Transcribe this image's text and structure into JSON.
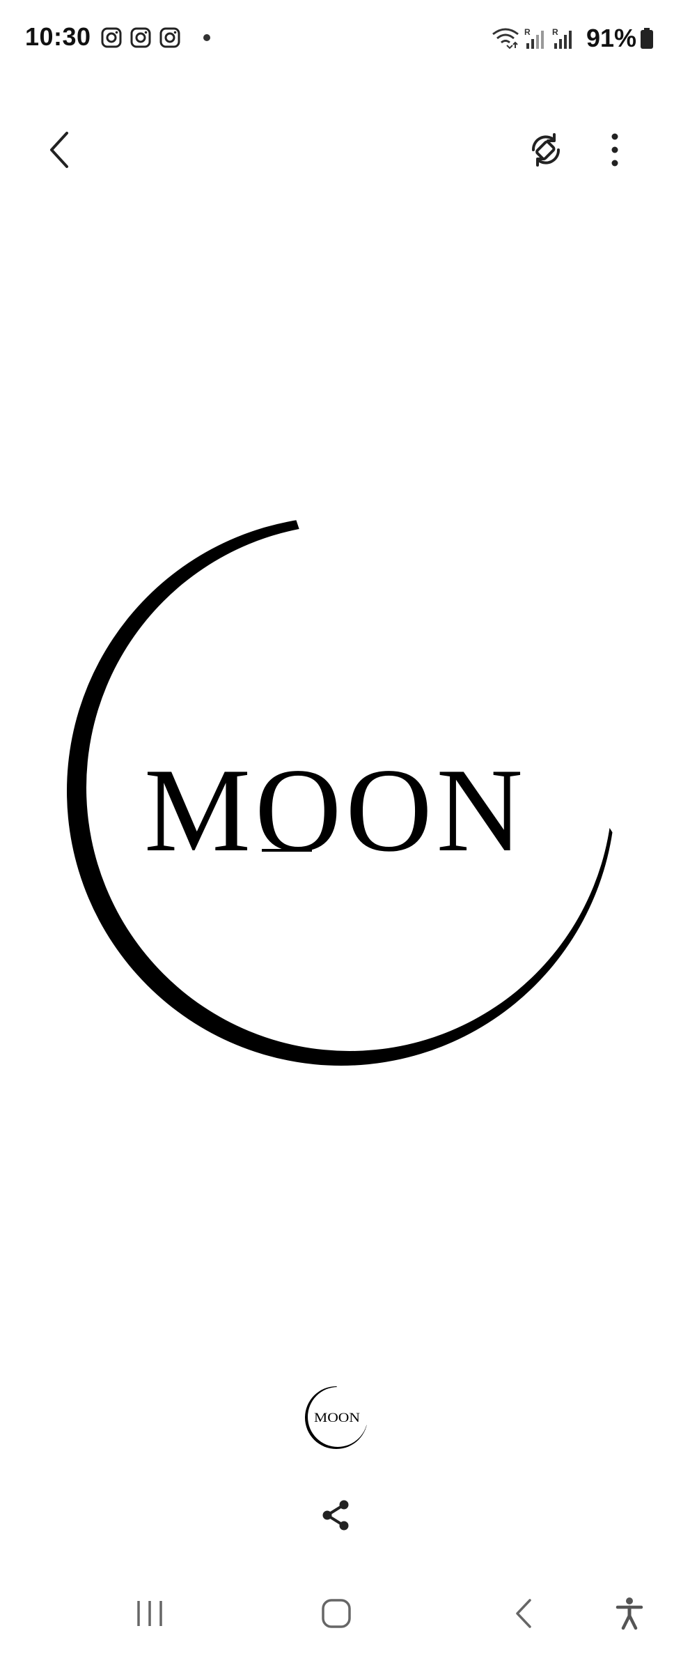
{
  "status_bar": {
    "time": "10:30",
    "notification_icons": [
      "instagram-icon",
      "instagram-icon",
      "instagram-icon",
      "dot-icon"
    ],
    "status_icons": [
      "wifi-icon",
      "signal-icon",
      "signal-icon"
    ],
    "signal_labels": [
      "R",
      "R"
    ],
    "battery_percent": "91%"
  },
  "top_bar": {
    "back_icon": "chevron-left-icon",
    "rotate_icon": "screen-rotate-icon",
    "more_icon": "more-vertical-icon"
  },
  "image": {
    "logo_text": "MOON",
    "thumbnail_text": "MOON",
    "ink_color": "#000000",
    "background_color": "#ffffff"
  },
  "actions": {
    "share_icon": "share-icon"
  },
  "nav_bar": {
    "items": [
      "recents-icon",
      "home-icon",
      "back-icon",
      "accessibility-icon"
    ]
  }
}
